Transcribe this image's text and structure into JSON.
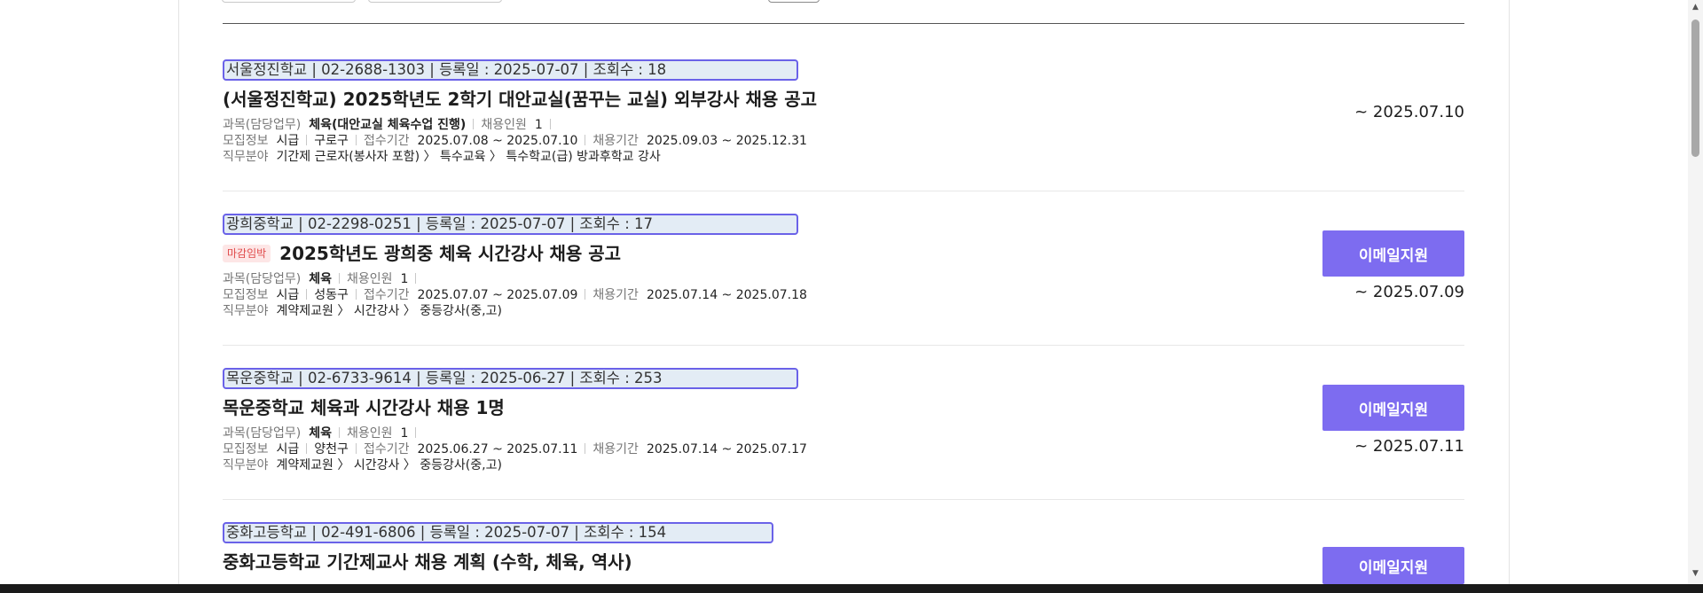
{
  "jobs": [
    {
      "meta": "서울정진학교 | 02-2688-1303 | 등록일 : 2025-07-07 | 조회수 : 18",
      "tag": "",
      "title": "(서울정진학교) 2025학년도 2학기 대안교실(꿈꾸는 교실) 외부강사 채용 공고",
      "subject_label": "과목(담당업무)",
      "subject": "체육(대안교실 체육수업 진행)",
      "hires_label": "채용인원",
      "hires": "1",
      "recruit_label": "모집정보",
      "level": "시급",
      "district": "구로구",
      "apply_label": "접수기간",
      "apply_period": "2025.07.08 ~ 2025.07.10",
      "employ_label": "채용기간",
      "employ_period": "2025.09.03 ~ 2025.12.31",
      "field_label": "직무분야",
      "field": "기간제 근로자(봉사자 포함) 〉 특수교육 〉 특수학교(급) 방과후학교 강사",
      "button": "",
      "deadline": "~ 2025.07.10"
    },
    {
      "meta": "광희중학교 | 02-2298-0251 | 등록일 : 2025-07-07 | 조회수 : 17",
      "tag": "마감임박",
      "title": "2025학년도 광희중 체육 시간강사 채용 공고",
      "subject_label": "과목(담당업무)",
      "subject": "체육",
      "hires_label": "채용인원",
      "hires": "1",
      "recruit_label": "모집정보",
      "level": "시급",
      "district": "성동구",
      "apply_label": "접수기간",
      "apply_period": "2025.07.07 ~ 2025.07.09",
      "employ_label": "채용기간",
      "employ_period": "2025.07.14 ~ 2025.07.18",
      "field_label": "직무분야",
      "field": "계약제교원 〉 시간강사 〉 중등강사(중,고)",
      "button": "이메일지원",
      "deadline": "~ 2025.07.09"
    },
    {
      "meta": "목운중학교 | 02-6733-9614 | 등록일 : 2025-06-27 | 조회수 : 253",
      "tag": "",
      "title": "목운중학교 체육과 시간강사 채용 1명",
      "subject_label": "과목(담당업무)",
      "subject": "체육",
      "hires_label": "채용인원",
      "hires": "1",
      "recruit_label": "모집정보",
      "level": "시급",
      "district": "양천구",
      "apply_label": "접수기간",
      "apply_period": "2025.06.27 ~ 2025.07.11",
      "employ_label": "채용기간",
      "employ_period": "2025.07.14 ~ 2025.07.17",
      "field_label": "직무분야",
      "field": "계약제교원 〉 시간강사 〉 중등강사(중,고)",
      "button": "이메일지원",
      "deadline": "~ 2025.07.11"
    },
    {
      "meta": "중화고등학교 | 02-491-6806 | 등록일 : 2025-07-07 | 조회수 : 154",
      "tag": "",
      "title": "중화고등학교 기간제교사 채용 계획 (수학, 체육, 역사)",
      "button": "이메일지원"
    }
  ]
}
